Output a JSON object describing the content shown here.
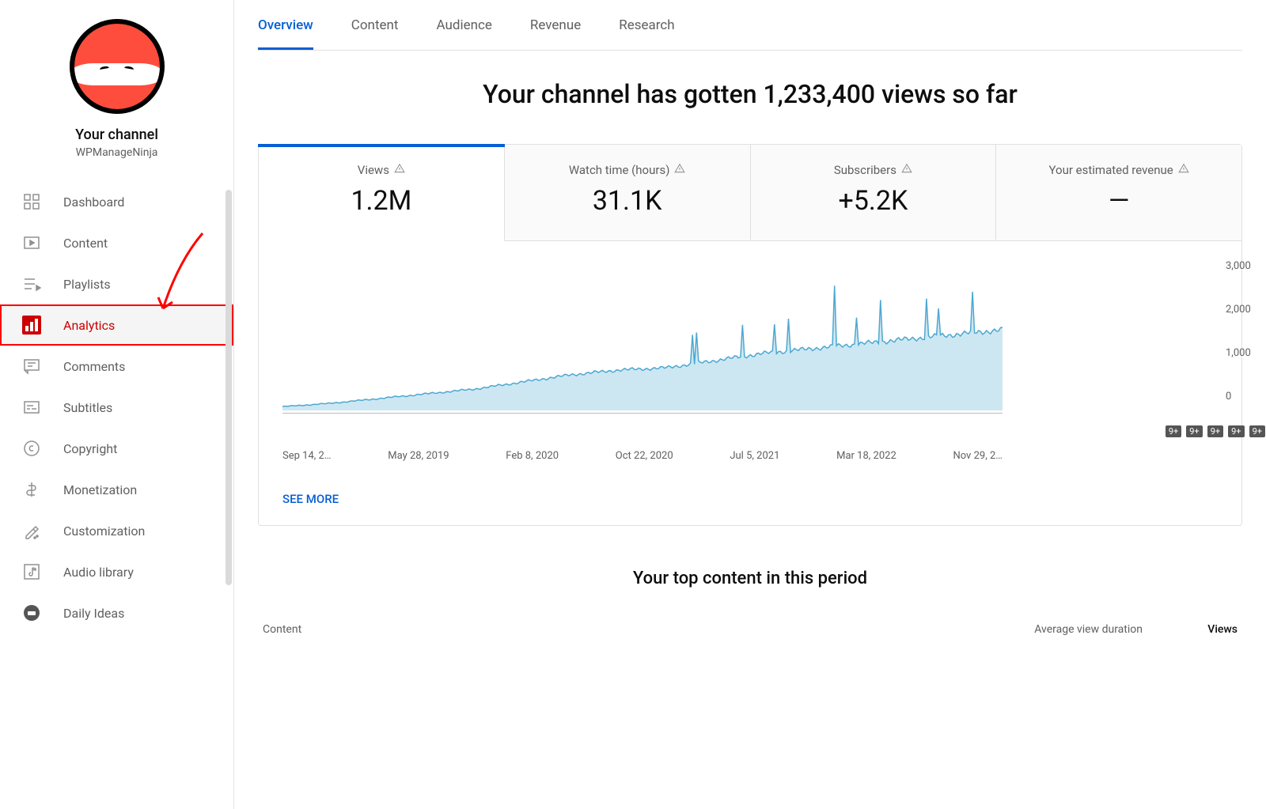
{
  "sidebar": {
    "your_channel_label": "Your channel",
    "channel_name": "WPManageNinja",
    "items": [
      {
        "label": "Dashboard",
        "name": "dashboard"
      },
      {
        "label": "Content",
        "name": "content"
      },
      {
        "label": "Playlists",
        "name": "playlists"
      },
      {
        "label": "Analytics",
        "name": "analytics"
      },
      {
        "label": "Comments",
        "name": "comments"
      },
      {
        "label": "Subtitles",
        "name": "subtitles"
      },
      {
        "label": "Copyright",
        "name": "copyright"
      },
      {
        "label": "Monetization",
        "name": "monetization"
      },
      {
        "label": "Customization",
        "name": "customization"
      },
      {
        "label": "Audio library",
        "name": "audio-library"
      },
      {
        "label": "Daily Ideas",
        "name": "daily-ideas"
      }
    ],
    "active_index": 3
  },
  "tabs": {
    "items": [
      "Overview",
      "Content",
      "Audience",
      "Revenue",
      "Research"
    ],
    "active_index": 0
  },
  "headline": "Your channel has gotten 1,233,400 views so far",
  "metrics": [
    {
      "label": "Views",
      "value": "1.2M"
    },
    {
      "label": "Watch time (hours)",
      "value": "31.1K"
    },
    {
      "label": "Subscribers",
      "value": "+5.2K"
    },
    {
      "label": "Your estimated revenue",
      "value": "—"
    }
  ],
  "see_more": "SEE MORE",
  "top_content_title": "Your top content in this period",
  "table_headers": {
    "content": "Content",
    "avg": "Average view duration",
    "views": "Views"
  },
  "badge_text": "9+",
  "chart_data": {
    "type": "area",
    "title": "Views",
    "xlabel": "",
    "ylabel": "",
    "ylim": [
      0,
      3000
    ],
    "y_ticks": [
      "3,000",
      "2,000",
      "1,000",
      "0"
    ],
    "x_ticks": [
      "Sep 14, 2…",
      "May 28, 2019",
      "Feb 8, 2020",
      "Oct 22, 2020",
      "Jul 5, 2021",
      "Mar 18, 2022",
      "Nov 29, 2…"
    ],
    "series": [
      {
        "name": "Views",
        "color": "#62b5d8",
        "x": [
          "Sep 14, 2018",
          "Jan 2019",
          "May 28, 2019",
          "Oct 2019",
          "Feb 8, 2020",
          "Jun 2020",
          "Oct 22, 2020",
          "Jan 2021",
          "Apr 2021",
          "Jul 5, 2021",
          "Oct 2021",
          "Jan 2022",
          "Mar 18, 2022",
          "Jun 2022",
          "Sep 2022",
          "Nov 29, 2022"
        ],
        "values": [
          80,
          150,
          250,
          350,
          450,
          600,
          750,
          850,
          900,
          1050,
          1200,
          1300,
          1400,
          1500,
          1600,
          1700
        ]
      }
    ]
  }
}
